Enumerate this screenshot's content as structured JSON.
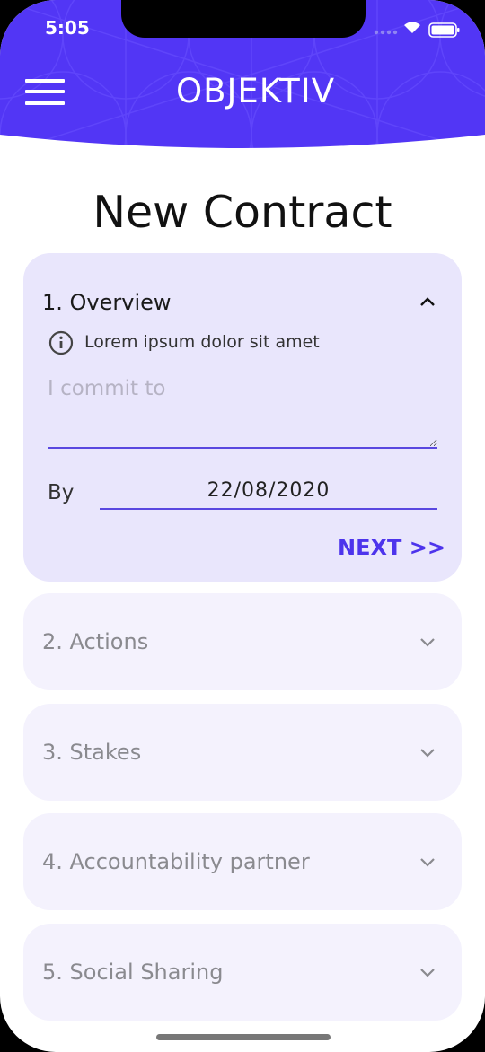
{
  "status_bar": {
    "time": "5:05"
  },
  "header": {
    "logo": "OBJEKTIV"
  },
  "page": {
    "title": "New Contract"
  },
  "sections": [
    {
      "title": "1. Overview",
      "expanded": true,
      "info_text": "Lorem ipsum dolor sit amet",
      "commit_placeholder": "I commit to",
      "commit_value": "",
      "by_label": "By",
      "date_value": "22/08/2020",
      "next_label": "NEXT >>"
    },
    {
      "title": "2. Actions",
      "expanded": false
    },
    {
      "title": "3. Stakes",
      "expanded": false
    },
    {
      "title": "4. Accountability partner",
      "expanded": false
    },
    {
      "title": "5. Social Sharing",
      "expanded": false
    }
  ],
  "colors": {
    "brand": "#5236f5",
    "open_panel_bg": "#e9e6fc",
    "closed_panel_bg": "#f4f2fd",
    "accent_line": "#5a48e0",
    "next_text": "#4d34ec"
  }
}
